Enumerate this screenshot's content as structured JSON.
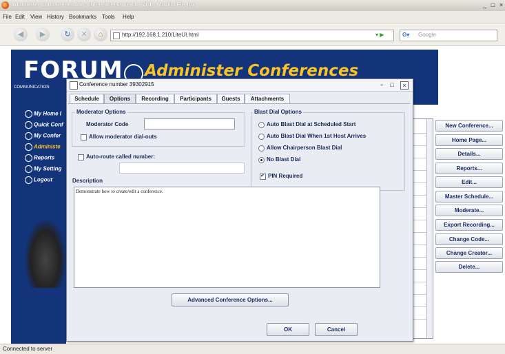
{
  "browser": {
    "title": "Administer conferences for conference server at 7201 - Mozilla Firefox",
    "menu": [
      "File",
      "Edit",
      "View",
      "History",
      "Bookmarks",
      "Tools",
      "Help"
    ],
    "url": "http://192.168.1.210/LiteUI.html",
    "search_placeholder": "Google",
    "status": "Connected to server"
  },
  "page": {
    "logo": "FORUM",
    "logo_sub": "COMMUNICATION",
    "title": "Administer Conferences",
    "nav": [
      "My Home I",
      "Quick Conf",
      "My Confer",
      "Administe",
      "Reports",
      "My Setting",
      "Logout"
    ],
    "right_buttons": [
      "New Conference...",
      "Home Page...",
      "Details...",
      "Reports...",
      "Edit...",
      "Master Schedule...",
      "Moderate...",
      "Export Recording...",
      "Change Code...",
      "Change Creator...",
      "Delete..."
    ]
  },
  "dialog": {
    "title": "Conference number 39302915",
    "tabs": [
      "Schedule",
      "Options",
      "Recording",
      "Participants",
      "Guests",
      "Attachments"
    ],
    "active_tab": "Options",
    "moderator": {
      "group_label": "Moderator Options",
      "code_label": "Moderator Code",
      "code_value": "",
      "allow_dialouts_label": "Allow moderator dial-outs",
      "allow_dialouts_checked": false
    },
    "autoroute": {
      "label": "Auto-route called number:",
      "checked": false,
      "value": ""
    },
    "blast": {
      "group_label": "Blast Dial Options",
      "options": [
        "Auto Blast Dial at Scheduled Start",
        "Auto Blast Dial When 1st Host Arrives",
        "Allow Chairperson Blast Dial",
        "No Blast Dial"
      ],
      "selected": "No Blast Dial",
      "pin_label": "PIN Required",
      "pin_checked": true
    },
    "description_label": "Description",
    "description_text": "Demonstrate how to create/edit a conference.",
    "advanced_button": "Advanced Conference Options...",
    "ok_button": "OK",
    "cancel_button": "Cancel"
  }
}
